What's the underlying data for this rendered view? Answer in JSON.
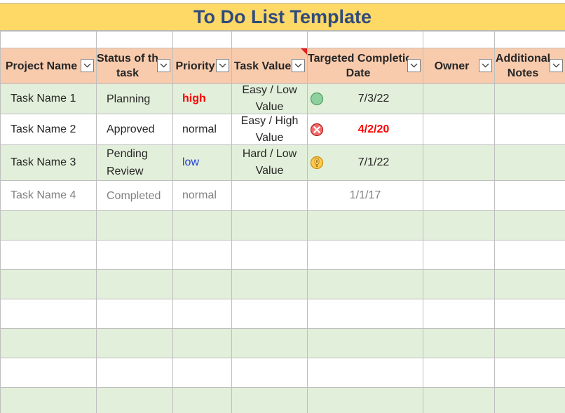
{
  "title": "To Do List Template",
  "columns": [
    {
      "label": "Project Name"
    },
    {
      "label_line1": "Status of the",
      "label_line2": "task"
    },
    {
      "label": "Priority"
    },
    {
      "label": "Task Value"
    },
    {
      "label_line1": "Targeted Completion",
      "label_line2": "Date"
    },
    {
      "label": "Owner"
    },
    {
      "label_line1": "Additional",
      "label_line2": "Notes"
    }
  ],
  "icons": {
    "filter": "chevron-down-icon",
    "on_track": "green-circle-icon",
    "overdue": "red-x-circle-icon",
    "warning": "yellow-exclamation-icon"
  },
  "colors": {
    "title_bg": "#ffd966",
    "title_text": "#2f4a7c",
    "header_bg": "#f8cbad",
    "band": "#e2efda",
    "high": "#ff0000",
    "low": "#1f3fd6",
    "completed_text": "#808080"
  },
  "rows": [
    {
      "name": "Task Name 1",
      "status": "Planning",
      "priority": "high",
      "value_line1": "Easy / Low",
      "value_line2": "Value",
      "date": "7/3/22",
      "owner": "",
      "notes": ""
    },
    {
      "name": "Task Name 2",
      "status": "Approved",
      "priority": "normal",
      "value_line1": "Easy / High",
      "value_line2": "Value",
      "date": "4/2/20",
      "owner": "",
      "notes": ""
    },
    {
      "name": "Task Name 3",
      "status_line1": "Pending",
      "status_line2": "Review",
      "priority": "low",
      "value_line1": "Hard / Low",
      "value_line2": "Value",
      "date": "7/1/22",
      "owner": "",
      "notes": ""
    },
    {
      "name": "Task Name 4",
      "status": "Completed",
      "priority": "normal",
      "value": "",
      "date": "1/1/17",
      "owner": "",
      "notes": ""
    }
  ]
}
